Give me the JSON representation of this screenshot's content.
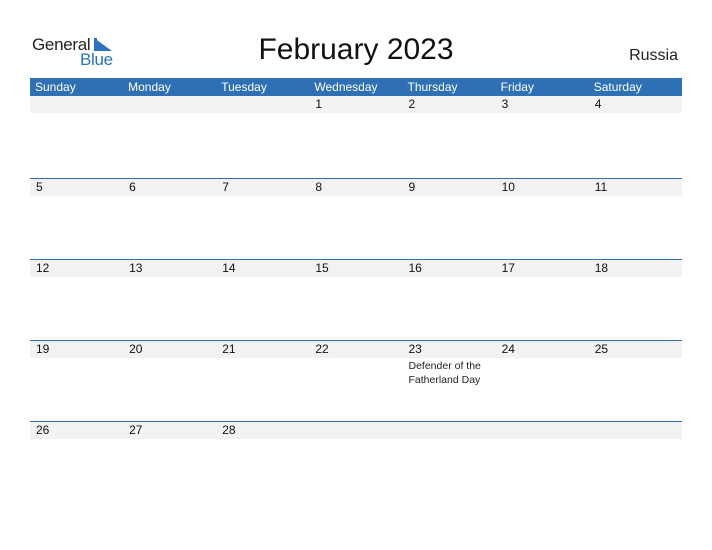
{
  "logo": {
    "text_general": "General",
    "text_blue": "Blue"
  },
  "title": "February 2023",
  "country": "Russia",
  "colors": {
    "accent": "#2e70b3",
    "date_strip": "#f2f2f2",
    "logo_blue": "#2b73c0"
  },
  "weekdays": [
    "Sunday",
    "Monday",
    "Tuesday",
    "Wednesday",
    "Thursday",
    "Friday",
    "Saturday"
  ],
  "weeks": [
    {
      "days": [
        "",
        "",
        "",
        "1",
        "2",
        "3",
        "4"
      ],
      "notes": [
        "",
        "",
        "",
        "",
        "",
        "",
        ""
      ]
    },
    {
      "days": [
        "5",
        "6",
        "7",
        "8",
        "9",
        "10",
        "11"
      ],
      "notes": [
        "",
        "",
        "",
        "",
        "",
        "",
        ""
      ]
    },
    {
      "days": [
        "12",
        "13",
        "14",
        "15",
        "16",
        "17",
        "18"
      ],
      "notes": [
        "",
        "",
        "",
        "",
        "",
        "",
        ""
      ]
    },
    {
      "days": [
        "19",
        "20",
        "21",
        "22",
        "23",
        "24",
        "25"
      ],
      "notes": [
        "",
        "",
        "",
        "",
        "Defender of the Fatherland Day",
        "",
        ""
      ]
    },
    {
      "days": [
        "26",
        "27",
        "28",
        "",
        "",
        "",
        ""
      ],
      "notes": [
        "",
        "",
        "",
        "",
        "",
        "",
        ""
      ]
    }
  ]
}
